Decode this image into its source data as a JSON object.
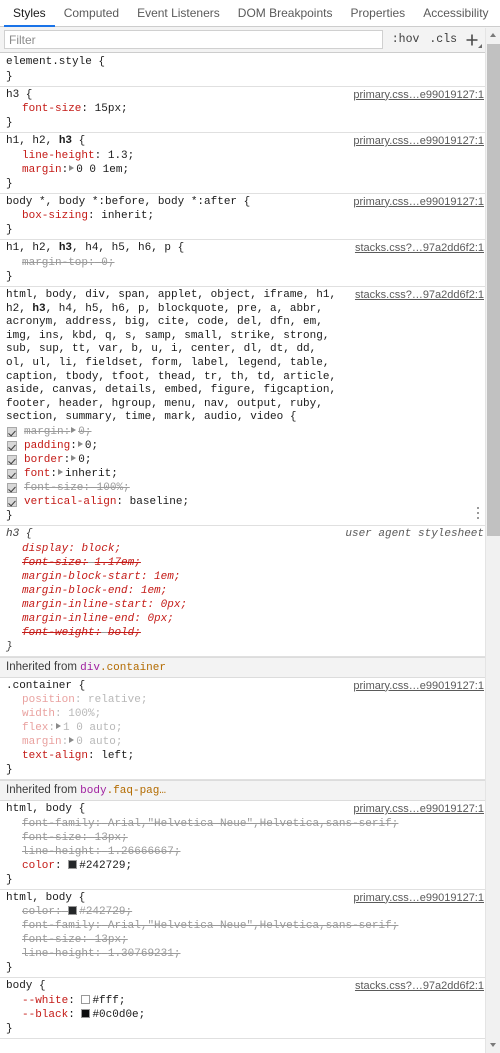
{
  "panel": {
    "tabs": [
      {
        "label": "Styles",
        "active": true
      },
      {
        "label": "Computed",
        "active": false
      },
      {
        "label": "Event Listeners",
        "active": false
      },
      {
        "label": "DOM Breakpoints",
        "active": false
      },
      {
        "label": "Properties",
        "active": false
      },
      {
        "label": "Accessibility",
        "active": false
      }
    ],
    "toolbar": {
      "filter_placeholder": "Filter",
      "filter_value": "",
      "hov_label": ":hov",
      "cls_label": ".cls",
      "new_rule_icon": "plus-icon",
      "new_rule_dropdown_icon": "chevron-down-icon"
    },
    "scrollbar": {
      "up_icon": "scroll-up-arrow-icon",
      "down_icon": "scroll-down-arrow-icon"
    },
    "accent_color": "#1a73e8",
    "property_color": "#c41a16",
    "inherited_tag_color": "#a020a0",
    "inherited_class_color": "#b36b00"
  },
  "sources": {
    "primary": "primary.css…e99019127:1",
    "stacks": "stacks.css?…97a2dd6f2:1",
    "user_agent": "user agent stylesheet"
  },
  "rules": [
    {
      "selector": "element.style",
      "origin": "",
      "declarations": []
    },
    {
      "selector": "h3",
      "origin": "primary.css…e99019127:1",
      "declarations": [
        {
          "prop": "font-size",
          "value": "15px"
        }
      ]
    },
    {
      "selector": "h1, h2, h3",
      "origin": "primary.css…e99019127:1",
      "declarations": [
        {
          "prop": "line-height",
          "value": "1.3"
        },
        {
          "prop": "margin",
          "value": "0 0 1em",
          "expandable": true
        }
      ]
    },
    {
      "selector": "body *, body *:before, body *:after",
      "origin": "primary.css…e99019127:1",
      "declarations": [
        {
          "prop": "box-sizing",
          "value": "inherit"
        }
      ]
    },
    {
      "selector": "h1, h2, h3, h4, h5, h6, p",
      "origin": "stacks.css?…97a2dd6f2:1",
      "declarations": [
        {
          "prop": "margin-top",
          "value": "0",
          "overridden": true
        }
      ]
    },
    {
      "selector": "html, body, div, span, applet, object, iframe, h1, h2, h3, h4, h5, h6, p, blockquote, pre, a, abbr, acronym, address, big, cite, code, del, dfn, em, img, ins, kbd, q, s, samp, small, strike, strong, sub, sup, tt, var, b, u, i, center, dl, dt, dd, ol, ul, li, fieldset, form, label, legend, table, caption, tbody, tfoot, thead, tr, th, td, article, aside, canvas, details, embed, figure, figcaption, footer, header, hgroup, menu, nav, output, ruby, section, summary, time, mark, audio, video",
      "origin": "stacks.css?…97a2dd6f2:1",
      "declarations": [
        {
          "prop": "margin",
          "value": "0",
          "checkbox": true,
          "expandable": true,
          "overridden": true
        },
        {
          "prop": "padding",
          "value": "0",
          "checkbox": true,
          "expandable": true
        },
        {
          "prop": "border",
          "value": "0",
          "checkbox": true,
          "expandable": true
        },
        {
          "prop": "font",
          "value": "inherit",
          "checkbox": true,
          "expandable": true
        },
        {
          "prop": "font-size",
          "value": "100%",
          "checkbox": true,
          "overridden": true
        },
        {
          "prop": "vertical-align",
          "value": "baseline",
          "checkbox": true
        }
      ],
      "has_kebab": true
    },
    {
      "selector": "h3",
      "origin": "user agent stylesheet",
      "user_agent": true,
      "declarations": [
        {
          "prop": "display",
          "value": "block"
        },
        {
          "prop": "font-size",
          "value": "1.17em",
          "overridden": true
        },
        {
          "prop": "margin-block-start",
          "value": "1em"
        },
        {
          "prop": "margin-block-end",
          "value": "1em"
        },
        {
          "prop": "margin-inline-start",
          "value": "0px"
        },
        {
          "prop": "margin-inline-end",
          "value": "0px"
        },
        {
          "prop": "font-weight",
          "value": "bold",
          "overridden": true
        }
      ]
    }
  ],
  "inherited_sections": [
    {
      "label": "Inherited from",
      "tag": "div",
      "cls": ".container",
      "rules": [
        {
          "selector": ".container",
          "origin": "primary.css…e99019127:1",
          "declarations": [
            {
              "prop": "position",
              "value": "relative",
              "dim": true
            },
            {
              "prop": "width",
              "value": "100%",
              "dim": true
            },
            {
              "prop": "flex",
              "value": "1 0 auto",
              "dim": true,
              "expandable": true
            },
            {
              "prop": "margin",
              "value": "0 auto",
              "dim": true,
              "expandable": true
            },
            {
              "prop": "text-align",
              "value": "left"
            }
          ]
        }
      ]
    },
    {
      "label": "Inherited from",
      "tag": "body",
      "cls": ".faq-pag…",
      "rules": [
        {
          "selector": "html, body",
          "origin": "primary.css…e99019127:1",
          "declarations": [
            {
              "prop": "font-family",
              "value": "Arial,\"Helvetica Neue\",Helvetica,sans-serif",
              "overridden": true
            },
            {
              "prop": "font-size",
              "value": "13px",
              "overridden": true
            },
            {
              "prop": "line-height",
              "value": "1.26666667",
              "overridden": true
            },
            {
              "prop": "color",
              "value": "#242729",
              "swatch": "#242729"
            }
          ]
        },
        {
          "selector": "html, body",
          "origin": "primary.css…e99019127:1",
          "declarations": [
            {
              "prop": "color",
              "value": "#242729",
              "swatch": "#242729",
              "overridden": true
            },
            {
              "prop": "font-family",
              "value": "Arial,\"Helvetica Neue\",Helvetica,sans-serif",
              "overridden": true
            },
            {
              "prop": "font-size",
              "value": "13px",
              "overridden": true
            },
            {
              "prop": "line-height",
              "value": "1.30769231",
              "overridden": true
            }
          ]
        },
        {
          "selector": "body",
          "origin": "stacks.css?…97a2dd6f2:1",
          "declarations": [
            {
              "prop": "--white",
              "value": "#fff",
              "swatch": "#ffffff"
            },
            {
              "prop": "--black",
              "value": "#0c0d0e",
              "swatch": "#0c0d0e"
            }
          ]
        }
      ]
    }
  ]
}
